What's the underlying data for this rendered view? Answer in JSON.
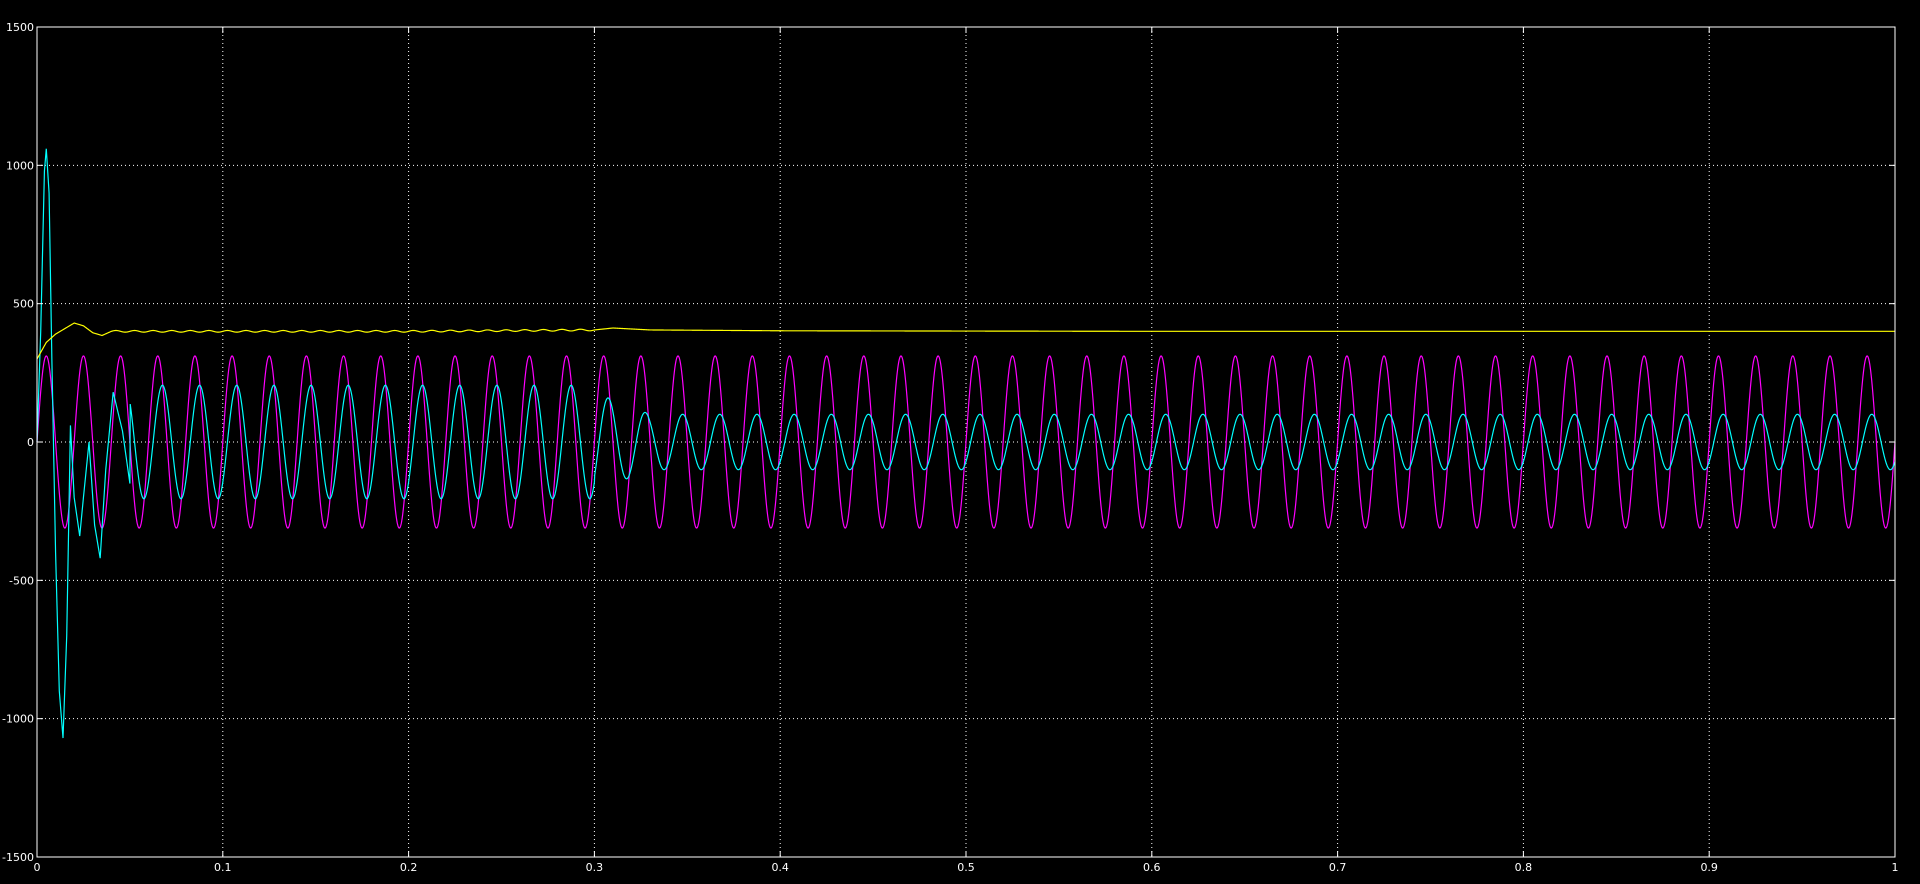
{
  "chart_data": {
    "type": "line",
    "title": "",
    "xlabel": "",
    "ylabel": "",
    "xlim": [
      0,
      1
    ],
    "ylim": [
      -1500,
      1500
    ],
    "grid": true,
    "grid_style": "dotted",
    "x_ticks": [
      0,
      0.1,
      0.2,
      0.3,
      0.4,
      0.5,
      0.6,
      0.7,
      0.8,
      0.9,
      1
    ],
    "y_ticks": [
      -1500,
      -1000,
      -500,
      0,
      500,
      1000,
      1500
    ],
    "x_tick_labels": [
      "0",
      "0.1",
      "0.2",
      "0.3",
      "0.4",
      "0.5",
      "0.6",
      "0.7",
      "0.8",
      "0.9",
      "1"
    ],
    "y_tick_labels": [
      "-1500",
      "-1000",
      "-500",
      "0",
      "500",
      "1000",
      "1500"
    ],
    "background_color": "#000000",
    "axes_color": "#ffffff",
    "series": [
      {
        "color": "#ff00ff",
        "shape": "sinusoid",
        "frequency_hz": 50,
        "amplitude": 311,
        "offset": 0,
        "sample_points": [
          {
            "x": 0.0,
            "y": 0
          },
          {
            "x": 0.005,
            "y": 311
          },
          {
            "x": 0.015,
            "y": -311
          },
          {
            "x": 0.5,
            "y": 0
          },
          {
            "x": 0.995,
            "y": -311
          },
          {
            "x": 1.0,
            "y": 0
          }
        ]
      },
      {
        "color": "#00ffff",
        "shape": "transient-then-sinusoid",
        "frequency_hz": 50,
        "transient_points": [
          {
            "x": 0.0,
            "y": 0
          },
          {
            "x": 0.002,
            "y": 400
          },
          {
            "x": 0.004,
            "y": 980
          },
          {
            "x": 0.005,
            "y": 1060
          },
          {
            "x": 0.0065,
            "y": 900
          },
          {
            "x": 0.008,
            "y": 300
          },
          {
            "x": 0.01,
            "y": -400
          },
          {
            "x": 0.012,
            "y": -900
          },
          {
            "x": 0.014,
            "y": -1070
          },
          {
            "x": 0.016,
            "y": -700
          },
          {
            "x": 0.018,
            "y": 60
          },
          {
            "x": 0.02,
            "y": -200
          },
          {
            "x": 0.023,
            "y": -340
          },
          {
            "x": 0.025,
            "y": -200
          },
          {
            "x": 0.028,
            "y": 0
          },
          {
            "x": 0.031,
            "y": -300
          },
          {
            "x": 0.034,
            "y": -420
          },
          {
            "x": 0.037,
            "y": -100
          },
          {
            "x": 0.041,
            "y": 180
          },
          {
            "x": 0.046,
            "y": 40
          },
          {
            "x": 0.05,
            "y": -150
          }
        ],
        "segments": [
          {
            "x_start": 0.05,
            "x_end": 0.3,
            "amplitude": 205,
            "offset": 0
          },
          {
            "x_start": 0.3,
            "x_end": 1.0,
            "amplitude": 100,
            "offset": 0
          }
        ],
        "sample_points": [
          {
            "x": 0.065,
            "y": 220
          },
          {
            "x": 0.075,
            "y": -200
          },
          {
            "x": 0.285,
            "y": 205
          },
          {
            "x": 0.295,
            "y": -205
          },
          {
            "x": 0.305,
            "y": 150
          },
          {
            "x": 0.32,
            "y": -60
          },
          {
            "x": 0.985,
            "y": 100
          },
          {
            "x": 0.995,
            "y": -100
          }
        ]
      },
      {
        "color": "#ffff00",
        "shape": "step-response",
        "sample_points": [
          {
            "x": 0.0,
            "y": 300
          },
          {
            "x": 0.005,
            "y": 360
          },
          {
            "x": 0.01,
            "y": 390
          },
          {
            "x": 0.015,
            "y": 410
          },
          {
            "x": 0.02,
            "y": 430
          },
          {
            "x": 0.025,
            "y": 420
          },
          {
            "x": 0.03,
            "y": 395
          },
          {
            "x": 0.035,
            "y": 385
          },
          {
            "x": 0.04,
            "y": 400
          },
          {
            "x": 0.1,
            "y": 400
          },
          {
            "x": 0.2,
            "y": 400
          },
          {
            "x": 0.3,
            "y": 405
          },
          {
            "x": 0.31,
            "y": 412
          },
          {
            "x": 0.33,
            "y": 405
          },
          {
            "x": 0.4,
            "y": 402
          },
          {
            "x": 0.6,
            "y": 400
          },
          {
            "x": 0.8,
            "y": 400
          },
          {
            "x": 1.0,
            "y": 400
          }
        ]
      }
    ]
  }
}
